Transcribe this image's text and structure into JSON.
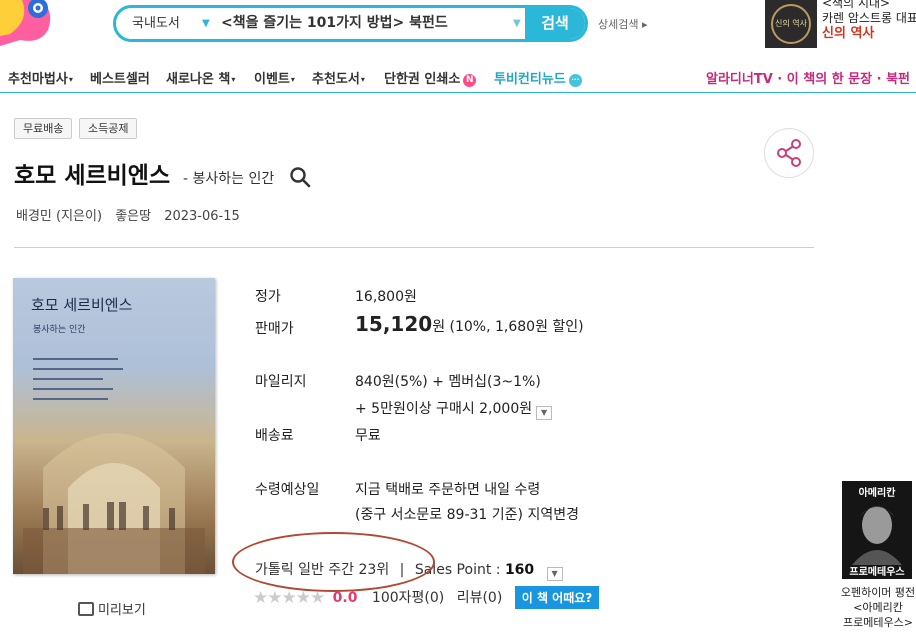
{
  "header": {
    "search_category": "국내도서",
    "search_query": "<책을 즐기는 101가지 방법> 북펀드",
    "search_button": "검색",
    "advanced_search": "상세검색 ▸"
  },
  "top_ad": {
    "line1": "<책의 시대>",
    "line2": "카렌 암스트롱 대표작",
    "line3": "신의 역사",
    "book_label": "신의 역사"
  },
  "nav": {
    "items": [
      {
        "label": "추천마법사",
        "arrow": "▾"
      },
      {
        "label": "베스트셀러",
        "arrow": ""
      },
      {
        "label": "새로나온 책",
        "arrow": "▾"
      },
      {
        "label": "이벤트",
        "arrow": "▾"
      },
      {
        "label": "추천도서",
        "arrow": "▾"
      },
      {
        "label": "단한권 인쇄소",
        "arrow": ""
      },
      {
        "label": "투비컨티뉴드",
        "arrow": ""
      }
    ],
    "badge_n": "N",
    "badge_dots": "···",
    "right_text": "알라디너TV · 이 책의 한 문장 · 북펀"
  },
  "tags": [
    "무료배송",
    "소득공제"
  ],
  "book": {
    "title": "호모 세르비엔스",
    "subtitle": "- 봉사하는 인간",
    "author": "배경민 (지은이)",
    "publisher": "좋은땅",
    "date": "2023-06-15",
    "cover_title": "호모 세르비엔스",
    "cover_subtitle": "봉사하는 인간",
    "preview": "미리보기"
  },
  "info": {
    "list_price_label": "정가",
    "list_price": "16,800원",
    "sale_price_label": "판매가",
    "sale_price": "15,120",
    "sale_price_unit": "원",
    "discount": "(10%, 1,680원 할인)",
    "mileage_label": "마일리지",
    "mileage_line1": "840원(5%) + 멤버십(3~1%)",
    "mileage_line2": "+ 5만원이상 구매시 2,000원",
    "shipping_label": "배송료",
    "shipping": "무료",
    "delivery_label": "수령예상일",
    "delivery_line1": "지금 택배로 주문하면 내일 수령",
    "delivery_line2": "(중구 서소문로 89-31 기준) 지역변경",
    "rank_text": "가톨릭 일반 주간 23위",
    "sales_point_label": "Sales Point : ",
    "sales_point": "160",
    "separator": "|",
    "rating_score": "0.0",
    "review_100": "100자평(0)",
    "review": "리뷰(0)",
    "how_button": "이 책 어때요?",
    "stars_filled": 0,
    "stars_total": 5
  },
  "side_ad": {
    "poster_top": "아메리칸",
    "poster_name": "프로메테우스",
    "line1": "오펜하이머 평전",
    "line2": "<아메리칸",
    "line3": "프로메테우스>"
  },
  "colors": {
    "accent": "#2ab7d8",
    "pink": "#c62a7a",
    "score": "#e53a6a",
    "button_blue": "#1a96e0"
  }
}
